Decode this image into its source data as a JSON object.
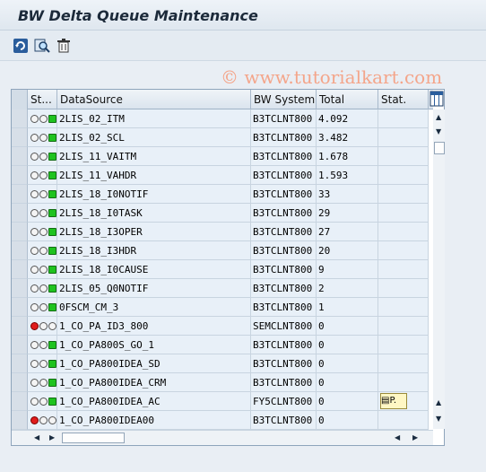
{
  "title": "BW Delta Queue Maintenance",
  "watermark": "© www.tutorialkart.com",
  "toolbar": {
    "refresh_icon": "refresh-icon",
    "display_icon": "magnifier-icon",
    "delete_icon": "trash-icon"
  },
  "grid": {
    "columns": [
      "St...",
      "DataSource",
      "BW System",
      "Total",
      "Stat."
    ],
    "rows": [
      {
        "status": "green",
        "datasource": "2LIS_02_ITM",
        "bw_system": "B3TCLNT800",
        "total": "4.092",
        "stat": ""
      },
      {
        "status": "green",
        "datasource": "2LIS_02_SCL",
        "bw_system": "B3TCLNT800",
        "total": "3.482",
        "stat": ""
      },
      {
        "status": "green",
        "datasource": "2LIS_11_VAITM",
        "bw_system": "B3TCLNT800",
        "total": "1.678",
        "stat": ""
      },
      {
        "status": "green",
        "datasource": "2LIS_11_VAHDR",
        "bw_system": "B3TCLNT800",
        "total": "1.593",
        "stat": ""
      },
      {
        "status": "green",
        "datasource": "2LIS_18_I0NOTIF",
        "bw_system": "B3TCLNT800",
        "total": "33",
        "stat": ""
      },
      {
        "status": "green",
        "datasource": "2LIS_18_I0TASK",
        "bw_system": "B3TCLNT800",
        "total": "29",
        "stat": ""
      },
      {
        "status": "green",
        "datasource": "2LIS_18_I3OPER",
        "bw_system": "B3TCLNT800",
        "total": "27",
        "stat": ""
      },
      {
        "status": "green",
        "datasource": "2LIS_18_I3HDR",
        "bw_system": "B3TCLNT800",
        "total": "20",
        "stat": ""
      },
      {
        "status": "green",
        "datasource": "2LIS_18_I0CAUSE",
        "bw_system": "B3TCLNT800",
        "total": "9",
        "stat": ""
      },
      {
        "status": "green",
        "datasource": "2LIS_05_Q0NOTIF",
        "bw_system": "B3TCLNT800",
        "total": "2",
        "stat": ""
      },
      {
        "status": "green",
        "datasource": "0FSCM_CM_3",
        "bw_system": "B3TCLNT800",
        "total": "1",
        "stat": ""
      },
      {
        "status": "red",
        "datasource": "1_CO_PA_ID3_800",
        "bw_system": "SEMCLNT800",
        "total": "0",
        "stat": ""
      },
      {
        "status": "green",
        "datasource": "1_CO_PA800S_GO_1",
        "bw_system": "B3TCLNT800",
        "total": "0",
        "stat": ""
      },
      {
        "status": "green",
        "datasource": "1_CO_PA800IDEA_SD",
        "bw_system": "B3TCLNT800",
        "total": "0",
        "stat": ""
      },
      {
        "status": "green",
        "datasource": "1_CO_PA800IDEA_CRM",
        "bw_system": "B3TCLNT800",
        "total": "0",
        "stat": ""
      },
      {
        "status": "green",
        "datasource": "1_CO_PA800IDEA_AC",
        "bw_system": "FY5CLNT800",
        "total": "0",
        "stat": "P."
      },
      {
        "status": "red",
        "datasource": "1_CO_PA800IDEA00",
        "bw_system": "B3TCLNT800",
        "total": "0",
        "stat": ""
      }
    ]
  }
}
